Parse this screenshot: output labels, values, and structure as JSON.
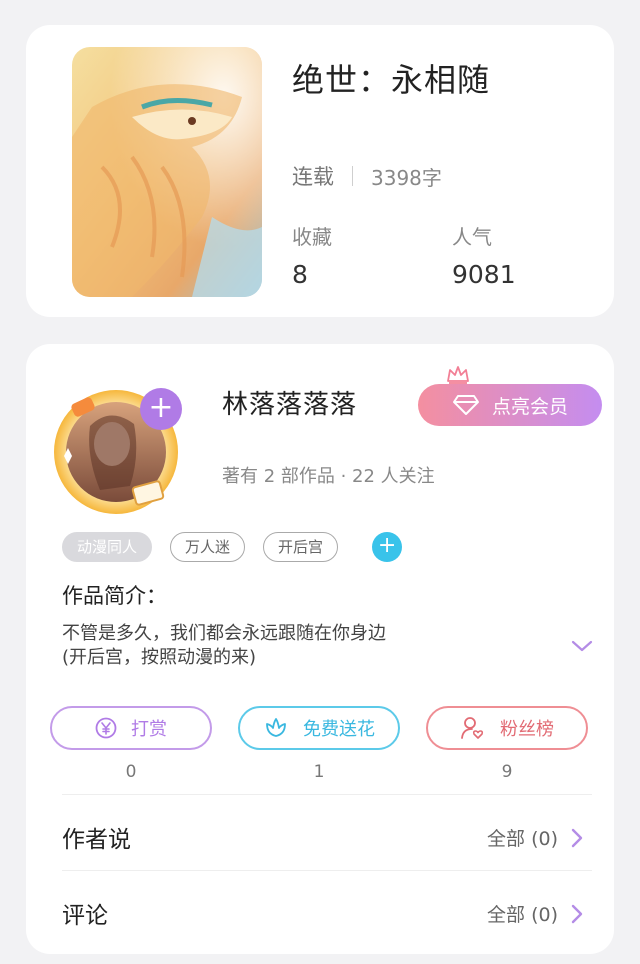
{
  "book": {
    "title": "绝世：永相随",
    "status": "连载",
    "word_count": "3398字",
    "favorites_label": "收藏",
    "favorites_value": "8",
    "popularity_label": "人气",
    "popularity_value": "9081"
  },
  "author": {
    "name": "林落落落落",
    "meta": "著有 2 部作品 · 22 人关注",
    "vip_button": "点亮会员"
  },
  "tags": [
    "动漫同人",
    "万人迷",
    "开后宫"
  ],
  "intro": {
    "title": "作品简介：",
    "text_line1": "不管是多久，我们都会永远跟随在你身边",
    "text_line2": "(开后宫，按照动漫的来)"
  },
  "actions": [
    {
      "label": "打赏",
      "count": "0",
      "icon": "yen-icon",
      "color": "#b07be6"
    },
    {
      "label": "免费送花",
      "count": "1",
      "icon": "flower-icon",
      "color": "#3ab8e0"
    },
    {
      "label": "粉丝榜",
      "count": "9",
      "icon": "fans-icon",
      "color": "#e26b74"
    }
  ],
  "sections": [
    {
      "label": "作者说",
      "link": "全部 (0)"
    },
    {
      "label": "评论",
      "link": "全部 (0)"
    }
  ]
}
